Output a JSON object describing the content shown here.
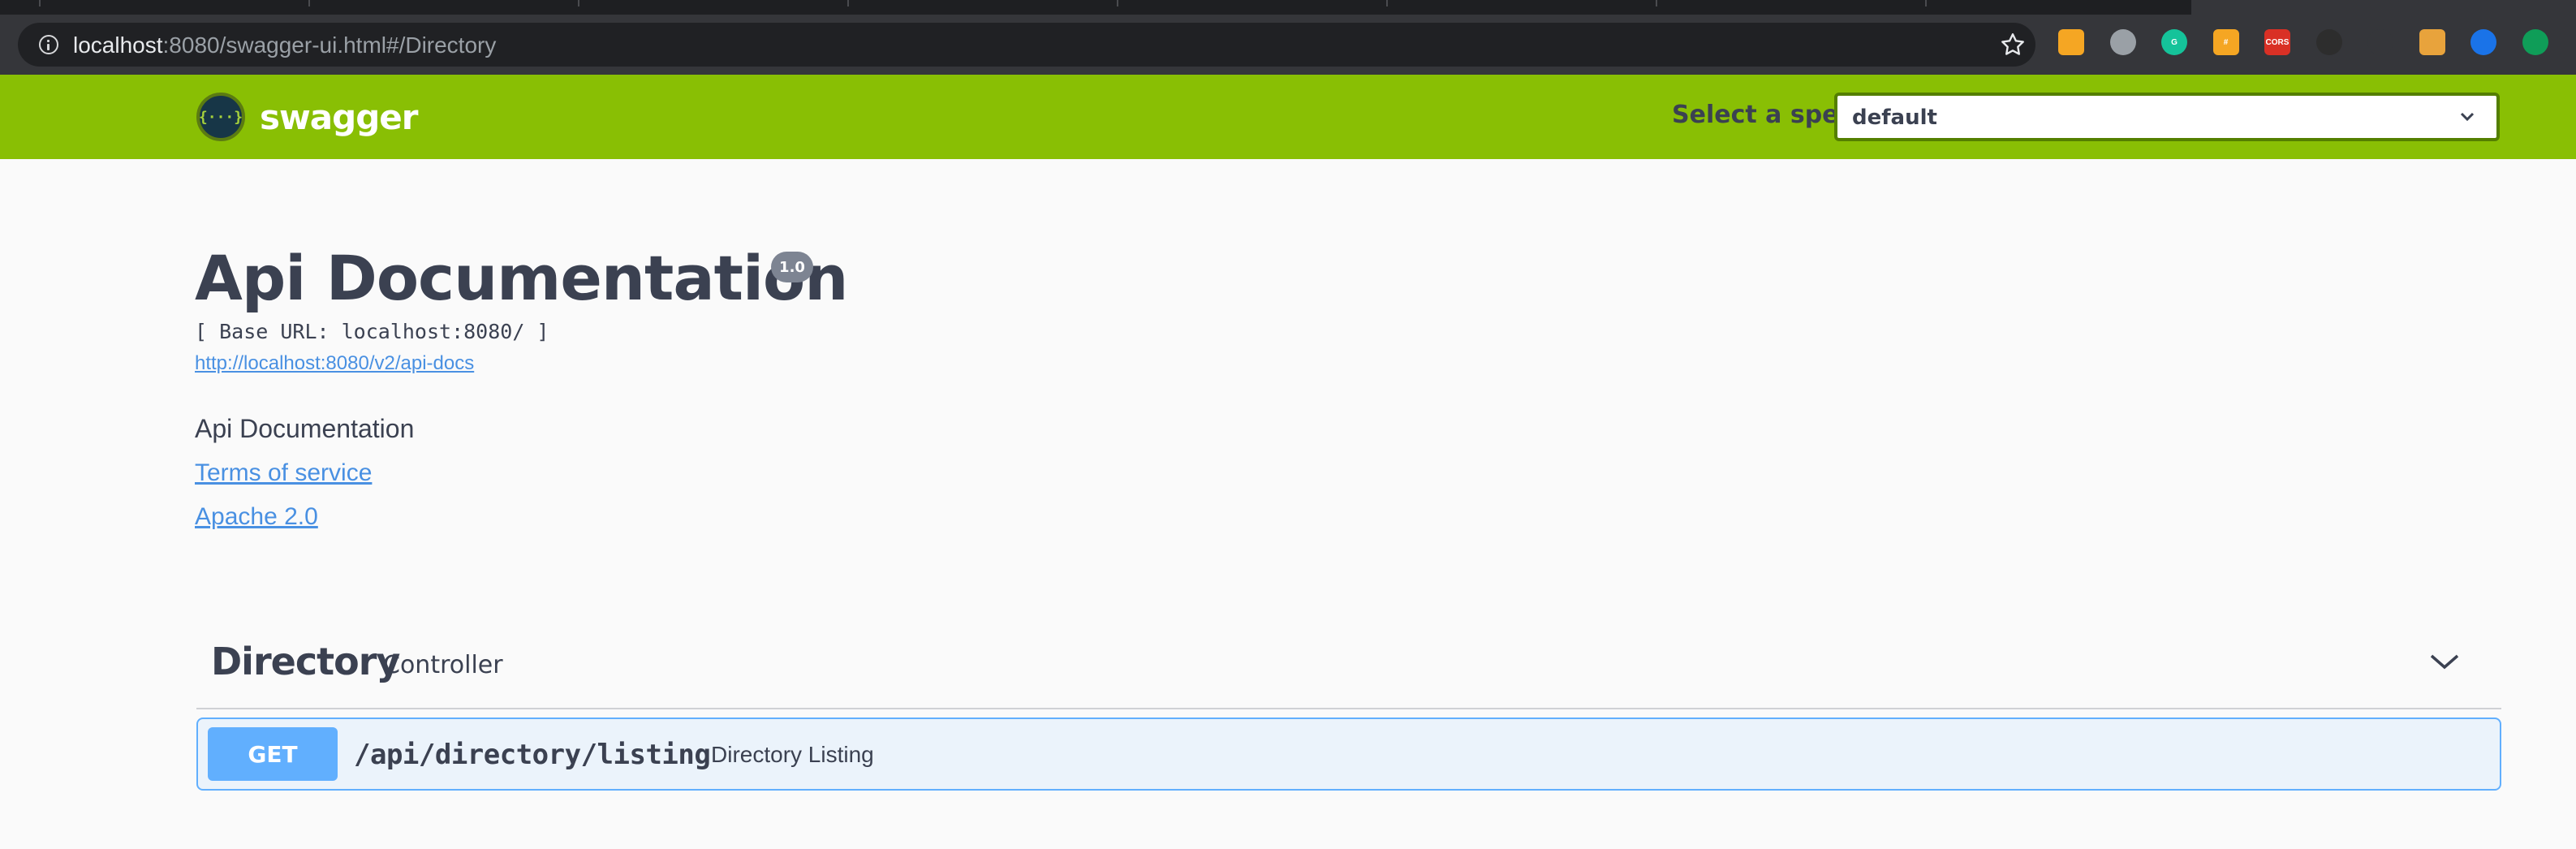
{
  "browser": {
    "url_host": "localhost",
    "url_rest": ":8080/swagger-ui.html#/Directory",
    "extensions": [
      {
        "name": "rss-extension-icon",
        "color": "#f5a623",
        "label": "",
        "shape": "square"
      },
      {
        "name": "circle-extension-icon",
        "color": "#9aa0a6",
        "label": "",
        "shape": "round"
      },
      {
        "name": "grammarly-icon",
        "color": "#15c39a",
        "label": "G",
        "shape": "round"
      },
      {
        "name": "hashtag-extension-icon",
        "color": "#f5a623",
        "label": "#",
        "shape": "square"
      },
      {
        "name": "cors-extension-icon",
        "color": "#d93025",
        "label": "CORS",
        "shape": "square"
      },
      {
        "name": "redux-devtools-icon",
        "color": "#2d2d2d",
        "label": "",
        "shape": "round"
      },
      {
        "name": "react-devtools-icon",
        "color": "#35363a",
        "label": "",
        "shape": "round"
      },
      {
        "name": "color-picker-extension-icon",
        "color": "#e8a33c",
        "label": "",
        "shape": "square"
      },
      {
        "name": "play-extension-icon",
        "color": "#1a73e8",
        "label": "",
        "shape": "round"
      },
      {
        "name": "green-dot-extension-icon",
        "color": "#0f9d58",
        "label": "",
        "shape": "round"
      }
    ]
  },
  "topbar": {
    "logo_text": "swagger",
    "logo_glyph": "{···}",
    "spec_label": "Select a spec",
    "spec_value": "default"
  },
  "info": {
    "title": "Api Documentation",
    "version": "1.0",
    "base_url": "[ Base URL: localhost:8080/ ]",
    "docs_url": "http://localhost:8080/v2/api-docs",
    "description": "Api Documentation",
    "terms_label": "Terms of service",
    "license_label": "Apache 2.0"
  },
  "tag": {
    "name": "Directory",
    "description": "Controller",
    "operations": [
      {
        "method": "GET",
        "path": "/api/directory/listing",
        "summary": "Directory Listing"
      }
    ]
  },
  "colors": {
    "topbar": "#89bf04",
    "get_method": "#61affe",
    "link": "#4990e2",
    "text": "#3b4151"
  }
}
